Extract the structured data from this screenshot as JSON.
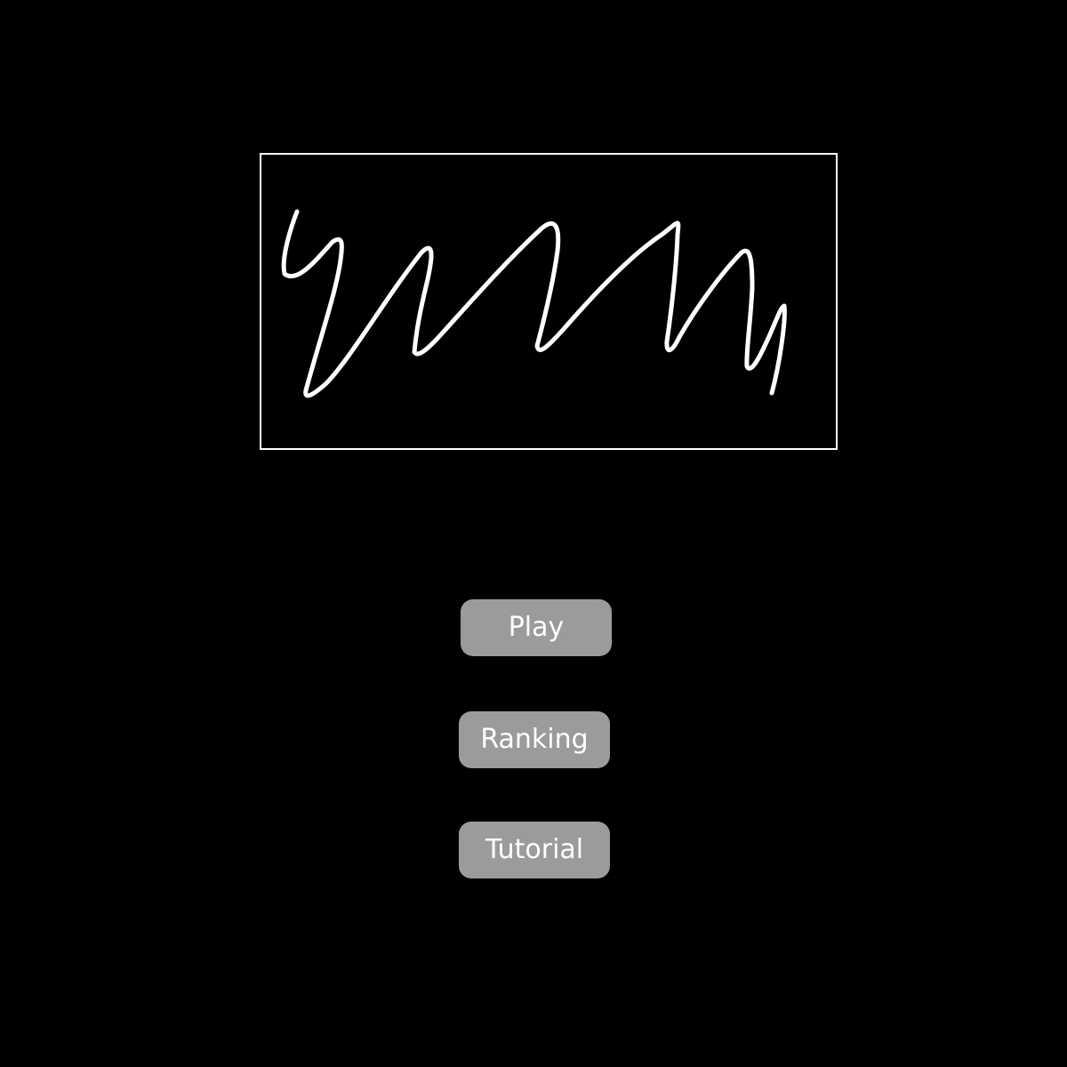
{
  "logo": {
    "icon": "scribble-logo-icon",
    "stroke_color": "#ffffff",
    "frame_color": "#ffffff"
  },
  "menu": {
    "play_label": "Play",
    "ranking_label": "Ranking",
    "tutorial_label": "Tutorial",
    "button_color": "#9b9b9b",
    "text_color": "#ffffff"
  },
  "background_color": "#000000"
}
